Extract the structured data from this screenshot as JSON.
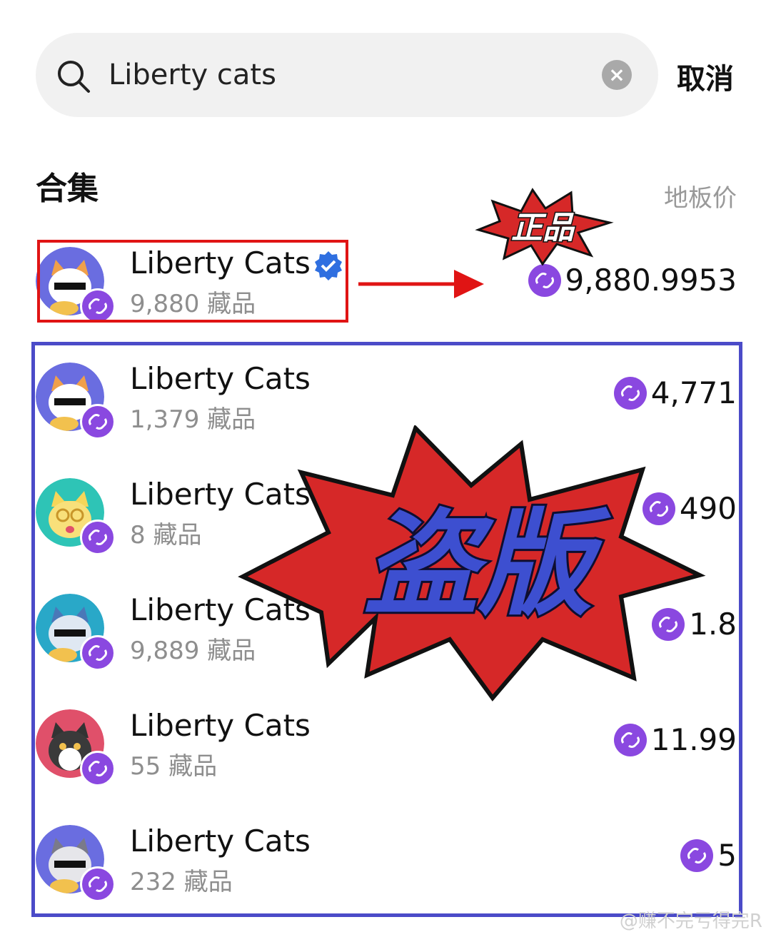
{
  "search": {
    "query": "Liberty cats",
    "cancel_label": "取消"
  },
  "section": {
    "title": "合集",
    "floor_price_header": "地板价"
  },
  "collections": [
    {
      "name": "Liberty Cats",
      "count": "9,880 藏品",
      "price": "9,880.9953",
      "verified": true,
      "avatar_bg": "#6a6de0"
    },
    {
      "name": "Liberty Cats",
      "count": "1,379 藏品",
      "price": "4,771",
      "verified": false,
      "avatar_bg": "#6a6de0"
    },
    {
      "name": "Liberty Cats",
      "count": "8 藏品",
      "price": "490",
      "verified": false,
      "avatar_bg": "#2ec4b6"
    },
    {
      "name": "Liberty Cats",
      "count": "9,889 藏品",
      "price": "1.8",
      "verified": false,
      "avatar_bg": "#29a8c8"
    },
    {
      "name": "Liberty Cats",
      "count": "55 藏品",
      "price": "11.99",
      "verified": false,
      "avatar_bg": "#e0506a"
    },
    {
      "name": "Liberty Cats",
      "count": "232 藏品",
      "price": "5",
      "verified": false,
      "avatar_bg": "#6a6de0"
    }
  ],
  "annotations": {
    "genuine_label": "正品",
    "pirated_label": "盗版"
  },
  "watermark": "@赚不完亏得完R",
  "colors": {
    "chain_badge": "#8a48e0",
    "red_mark": "#e01414",
    "blue_mark": "#4b4bc8",
    "pirated_text": "#3d4fd0"
  }
}
